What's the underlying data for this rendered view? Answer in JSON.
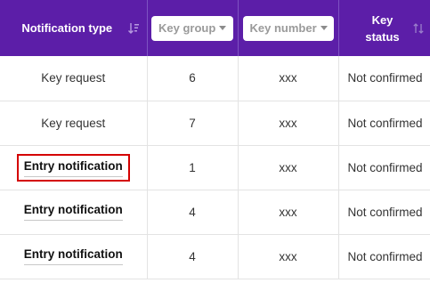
{
  "header": {
    "col_type": "Notification type",
    "col_group_filter": "Key group",
    "col_number_filter": "Key number",
    "col_status_line1": "Key",
    "col_status_line2": "status"
  },
  "rows": [
    {
      "type": "Key request",
      "type_bold": false,
      "group": "6",
      "number": "xxx",
      "status": "Not confirmed"
    },
    {
      "type": "Key request",
      "type_bold": false,
      "group": "7",
      "number": "xxx",
      "status": "Not confirmed"
    },
    {
      "type": "Entry notification",
      "type_bold": true,
      "highlighted": true,
      "group": "1",
      "number": "xxx",
      "status": "Not confirmed"
    },
    {
      "type": "Entry notification",
      "type_bold": true,
      "group": "4",
      "number": "xxx",
      "status": "Not confirmed"
    },
    {
      "type": "Entry notification",
      "type_bold": true,
      "group": "4",
      "number": "xxx",
      "status": "Not confirmed"
    }
  ],
  "colors": {
    "header_bg": "#5c1ea8",
    "highlight_border": "#d40000"
  },
  "icons": {
    "sort_active": "sort-descending-icon",
    "sort_inactive": "sort-icon"
  }
}
